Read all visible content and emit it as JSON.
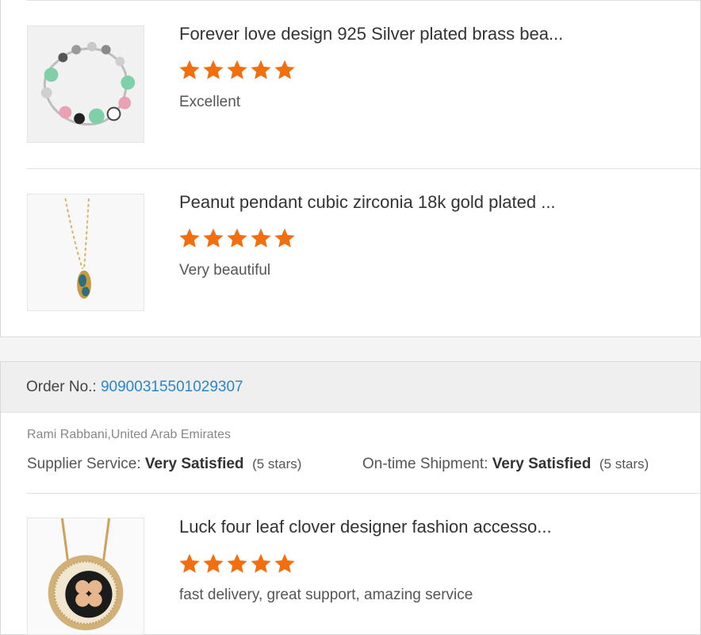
{
  "reviews_top": [
    {
      "title": "Forever love design 925 Silver plated brass bea...",
      "rating": 5,
      "comment": "Excellent",
      "image_icon": "bracelet-image"
    },
    {
      "title": "Peanut pendant cubic zirconia 18k gold plated ...",
      "rating": 5,
      "comment": "Very beautiful",
      "image_icon": "necklace-image"
    }
  ],
  "order": {
    "label": "Order No.:",
    "number": "90900315501029307",
    "buyer": "Rami Rabbani,United Arab Emirates",
    "supplier_label": "Supplier Service:",
    "supplier_value": "Very Satisfied",
    "supplier_stars": "(5 stars)",
    "shipment_label": "On-time Shipment:",
    "shipment_value": "Very Satisfied",
    "shipment_stars": "(5 stars)"
  },
  "review_order": {
    "title": "Luck four leaf clover designer fashion accesso...",
    "rating": 5,
    "comment": "fast delivery, great support, amazing service",
    "image_icon": "clover-pendant-image"
  },
  "colors": {
    "star": "#f36e0e",
    "link": "#2b86c9"
  }
}
